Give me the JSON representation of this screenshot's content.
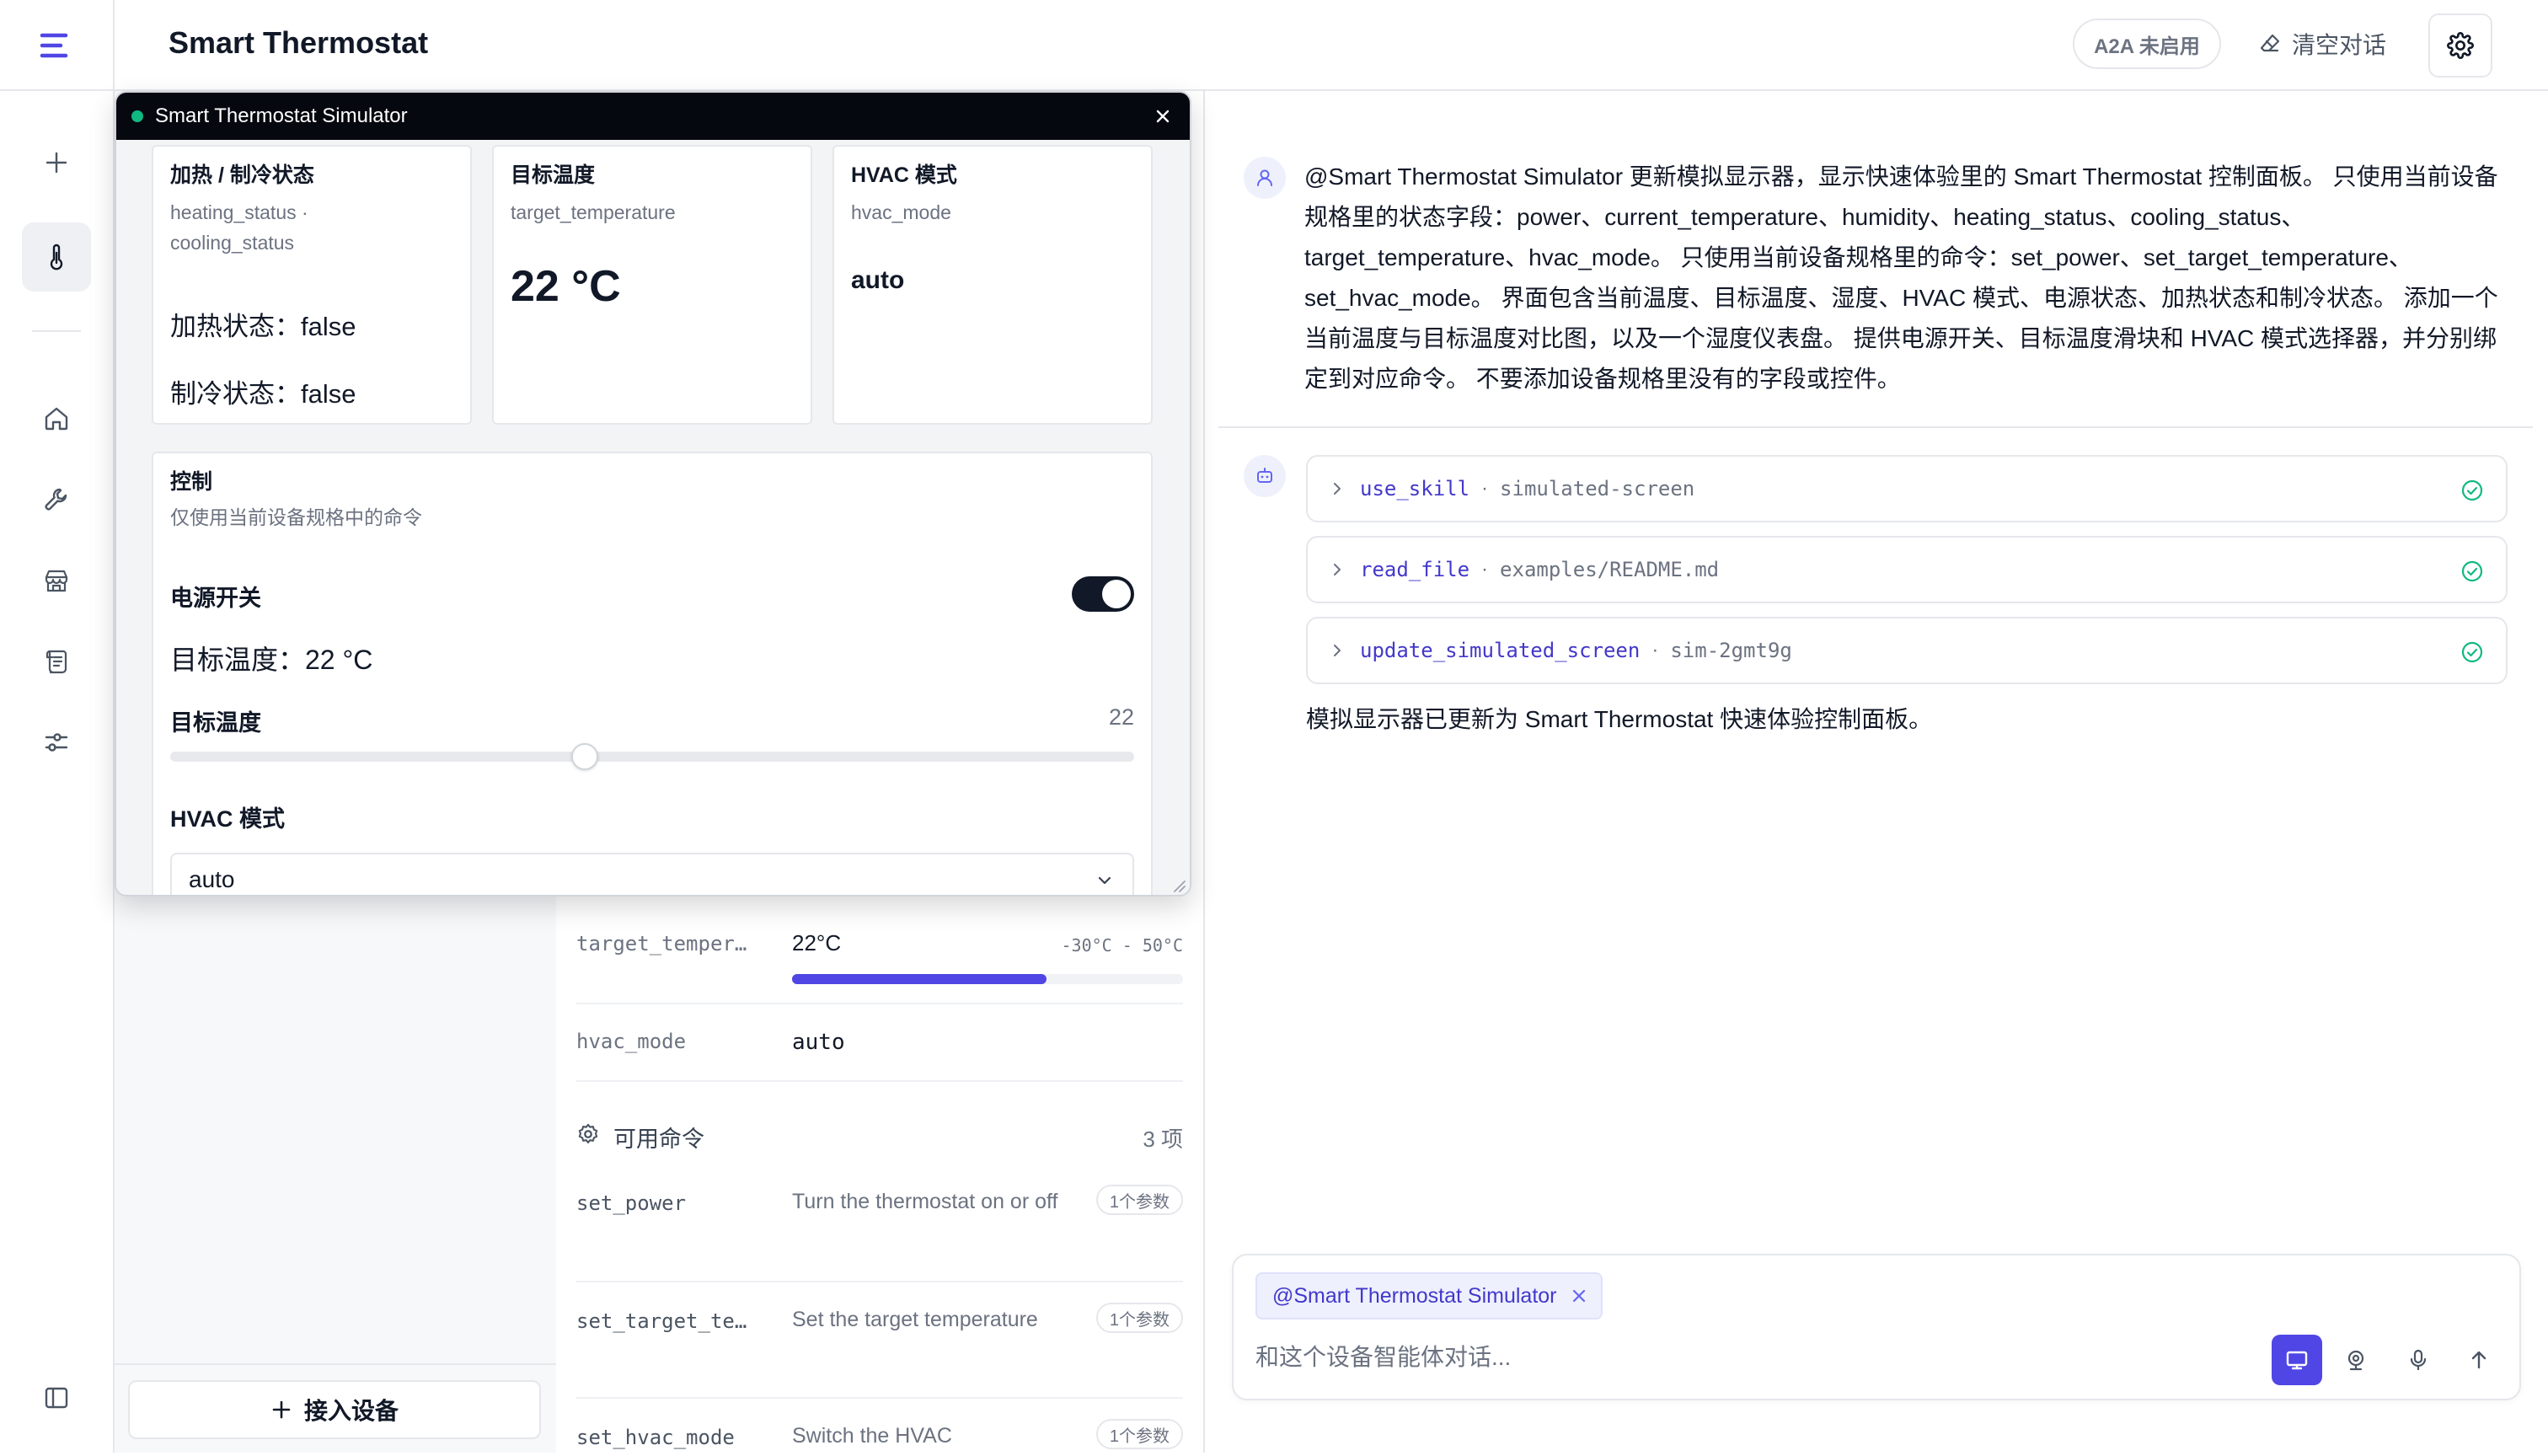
{
  "app": {
    "title": "Smart Thermostat",
    "a2a_badge": "A2A 未启用",
    "clear_label": "清空对话"
  },
  "sidebar": {
    "icons": [
      "menu-icon",
      "plus-icon",
      "thermometer-icon",
      "home-icon",
      "wrench-icon",
      "store-icon",
      "scroll-icon",
      "sliders-icon",
      "panel-left-icon"
    ],
    "active": "thermometer-icon"
  },
  "device_list": {
    "add_device_label": "接入设备"
  },
  "device_detail": {
    "state_rows": [
      {
        "key": "target_temper…",
        "value": "22°C",
        "range": "-30°C - 50°C",
        "progress": 0.65
      },
      {
        "key": "hvac_mode",
        "value": "auto"
      }
    ],
    "commands_title": "可用命令",
    "commands_count": "3 项",
    "commands": [
      {
        "name": "set_power",
        "desc": "Turn the thermostat on or off",
        "params": "1个参数"
      },
      {
        "name": "set_target_te…",
        "desc": "Set the target temperature",
        "params": "1个参数"
      },
      {
        "name": "set_hvac_mode",
        "desc": "Switch the HVAC",
        "params": "1个参数"
      }
    ]
  },
  "simulator": {
    "title": "Smart Thermostat Simulator",
    "cards": {
      "heat_cool": {
        "title": "加热 / 制冷状态",
        "subtitle_line1": "heating_status ·",
        "subtitle_line2": "cooling_status",
        "heating_line": "加热状态：false",
        "cooling_line": "制冷状态：false"
      },
      "target": {
        "title": "目标温度",
        "subtitle": "target_temperature",
        "value": "22 °C"
      },
      "hvac": {
        "title": "HVAC 模式",
        "subtitle": "hvac_mode",
        "value": "auto"
      }
    },
    "controls": {
      "title": "控制",
      "subtitle": "仅使用当前设备规格中的命令",
      "power_label": "电源开关",
      "power_on": true,
      "target_line": "目标温度：22 °C",
      "slider_label": "目标温度",
      "slider_value": "22",
      "slider_fraction": 0.43,
      "hvac_label": "HVAC 模式",
      "hvac_selected": "auto"
    }
  },
  "chat": {
    "user_message": "@Smart Thermostat Simulator 更新模拟显示器，显示快速体验里的 Smart Thermostat 控制面板。 只使用当前设备规格里的状态字段：power、current_temperature、humidity、heating_status、cooling_status、target_temperature、hvac_mode。 只使用当前设备规格里的命令：set_power、set_target_temperature、set_hvac_mode。 界面包含当前温度、目标温度、湿度、HVAC 模式、电源状态、加热状态和制冷状态。 添加一个当前温度与目标温度对比图，以及一个湿度仪表盘。 提供电源开关、目标温度滑块和 HVAC 模式选择器，并分别绑定到对应命令。 不要添加设备规格里没有的字段或控件。",
    "tool_calls": [
      {
        "name": "use_skill",
        "arg": "simulated-screen",
        "status": "success"
      },
      {
        "name": "read_file",
        "arg": "examples/README.md",
        "status": "success"
      },
      {
        "name": "update_simulated_screen",
        "arg": "sim-2gmt9g",
        "status": "success"
      }
    ],
    "tool_separator": "·",
    "bot_reply": "模拟显示器已更新为 Smart Thermostat 快速体验控制面板。",
    "composer": {
      "mention": "@Smart Thermostat Simulator",
      "placeholder": "和这个设备智能体对话..."
    }
  },
  "colors": {
    "accent": "#4f46e5",
    "title_bar": "#06080f",
    "status_dot": "#10b981",
    "success": "#10b981"
  }
}
